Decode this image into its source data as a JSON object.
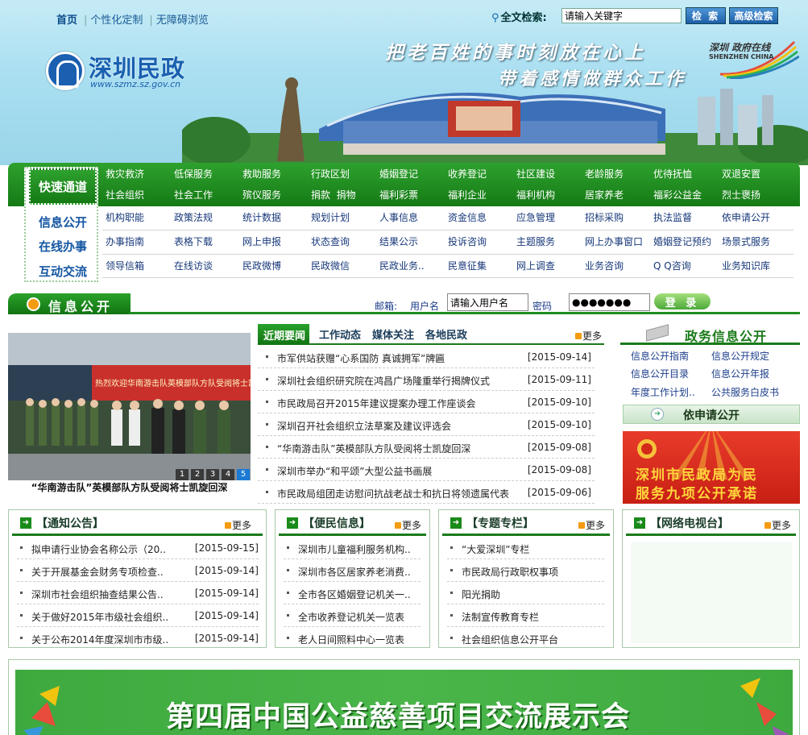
{
  "header": {
    "topnav": [
      "首页",
      "个性化定制",
      "无障碍浏览"
    ],
    "search_label": "全文检索:",
    "search_value": "请输入关键字",
    "search_btn": "检 索",
    "adv_btn": "高级检索",
    "logo_text": "深圳民政",
    "logo_url": "www.szmz.sz.gov.cn",
    "slogan1": "把老百姓的事时刻放在心上",
    "slogan2": "带着感情做群众工作",
    "sz_logo_cn": "深圳 政府在线",
    "sz_logo_en": "SHENZHEN CHINA"
  },
  "quicknav": {
    "title": "快速通道",
    "row1": [
      "救灾救济",
      "低保服务",
      "救助服务",
      "行政区划",
      "婚姻登记",
      "收养登记",
      "社区建设",
      "老龄服务",
      "优待抚恤",
      "双退安置"
    ],
    "row2": [
      "社会组织",
      "社会工作",
      "殡仪服务",
      "捐款  捐物",
      "福利彩票",
      "福利企业",
      "福利机构",
      "居家养老",
      "福彩公益金",
      "烈士褒扬"
    ],
    "labels": [
      "信息公开",
      "在线办事",
      "互动交流"
    ],
    "row3": [
      "机构职能",
      "政策法规",
      "统计数据",
      "规划计划",
      "人事信息",
      "资金信息",
      "应急管理",
      "招标采购",
      "执法监督",
      "依申请公开"
    ],
    "row4": [
      "办事指南",
      "表格下载",
      "网上申报",
      "状态查询",
      "结果公示",
      "投诉咨询",
      "主题服务",
      "网上办事窗口",
      "婚姻登记预约",
      "场景式服务"
    ],
    "row5": [
      "领导信箱",
      "在线访谈",
      "民政微博",
      "民政微信",
      "民政业务..",
      "民意征集",
      "网上调查",
      "业务咨询",
      "Q Q咨询",
      "业务知识库"
    ]
  },
  "infobar": {
    "title": "信息公开",
    "mailbox": "邮箱:",
    "username_label": "用户名",
    "username_value": "请输入用户名",
    "password_label": "密码",
    "password_value": "●●●●●●●",
    "login_btn": "登 录"
  },
  "photo": {
    "caption": "“华南游击队”英模部队方队受阅将士凯旋回深",
    "pages": [
      "1",
      "2",
      "3",
      "4",
      "5"
    ],
    "active_page": "5",
    "banner_text": "热烈欢迎华南游击队英模部队方队受阅将士凯旋欢迎仪式"
  },
  "news": {
    "tabs": [
      "近期要闻",
      "工作动态",
      "媒体关注",
      "各地民政"
    ],
    "more": "更多",
    "items": [
      {
        "title": "市军供站获赠“心系国防 真诚拥军”牌匾",
        "date": "[2015-09-14]"
      },
      {
        "title": "深圳社会组织研究院在鸿昌广场隆重举行揭牌仪式",
        "date": "[2015-09-11]"
      },
      {
        "title": "市民政局召开2015年建议提案办理工作座谈会",
        "date": "[2015-09-10]"
      },
      {
        "title": "深圳召开社会组织立法草案及建议评选会",
        "date": "[2015-09-10]"
      },
      {
        "title": "“华南游击队”英模部队方队受阅将士凯旋回深",
        "date": "[2015-09-08]"
      },
      {
        "title": "深圳市举办“和平颂”大型公益书画展",
        "date": "[2015-09-08]"
      },
      {
        "title": "市民政局组团走访慰问抗战老战士和抗日将领遗属代表",
        "date": "[2015-09-06]"
      }
    ]
  },
  "gov": {
    "title": "政务信息公开",
    "links": [
      "信息公开指南",
      "信息公开规定",
      "信息公开目录",
      "信息公开年报",
      "年度工作计划..",
      "公共服务白皮书"
    ],
    "apply": "依申请公开",
    "promise1": "深圳市民政局为民",
    "promise2": "服务九项公开承诺"
  },
  "boxes": [
    {
      "title": "【通知公告】",
      "more": "更多",
      "items": [
        {
          "title": "拟申请行业协会名称公示（20..",
          "date": "[2015-09-15]"
        },
        {
          "title": "关于开展基金会财务专项检查..",
          "date": "[2015-09-14]"
        },
        {
          "title": "深圳市社会组织抽查结果公告..",
          "date": "[2015-09-14]"
        },
        {
          "title": "关于做好2015年市级社会组织..",
          "date": "[2015-09-14]"
        },
        {
          "title": "关于公布2014年度深圳市市级..",
          "date": "[2015-09-14]"
        }
      ]
    },
    {
      "title": "【便民信息】",
      "more": "更多",
      "items": [
        {
          "title": "深圳市儿童福利服务机构..",
          "date": ""
        },
        {
          "title": "深圳市各区居家养老消费..",
          "date": ""
        },
        {
          "title": "全市各区婚姻登记机关一..",
          "date": ""
        },
        {
          "title": "全市收养登记机关一览表",
          "date": ""
        },
        {
          "title": "老人日间照料中心一览表",
          "date": ""
        }
      ]
    },
    {
      "title": "【专题专栏】",
      "more": "更多",
      "items": [
        {
          "title": "“大爱深圳”专栏",
          "date": ""
        },
        {
          "title": "市民政局行政职权事项",
          "date": ""
        },
        {
          "title": "阳光捐助",
          "date": ""
        },
        {
          "title": "法制宣传教育专栏",
          "date": ""
        },
        {
          "title": "社会组织信息公开平台",
          "date": ""
        }
      ]
    },
    {
      "title": "【网络电视台】",
      "more": "更多",
      "items": []
    }
  ],
  "banner": {
    "title": "第四届中国公益慈善项目交流展示会"
  },
  "colors": {
    "green": "#1a7a1a",
    "blue": "#1b3d8a",
    "orange": "#f39c12",
    "red": "#c81f14"
  }
}
